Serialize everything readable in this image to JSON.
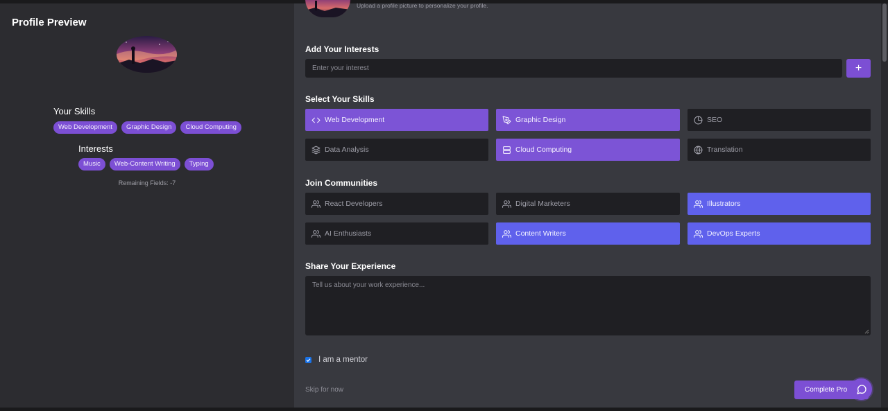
{
  "preview": {
    "title": "Profile Preview",
    "skills_heading": "Your Skills",
    "skills": [
      "Web Development",
      "Graphic Design",
      "Cloud Computing"
    ],
    "interests_heading": "Interests",
    "interests": [
      "Music",
      "Web-Content Writing",
      "Typing"
    ],
    "remaining": "Remaining Fields: -7"
  },
  "form": {
    "upload_hint": "Upload a profile picture to personalize your profile.",
    "interests_label": "Add Your Interests",
    "interest_placeholder": "Enter your interest",
    "add_label": "+",
    "skills_label": "Select Your Skills",
    "skills": [
      {
        "label": "Web Development",
        "icon": "code-icon",
        "selected": true
      },
      {
        "label": "Graphic Design",
        "icon": "pen-tool-icon",
        "selected": true
      },
      {
        "label": "SEO",
        "icon": "pie-chart-icon",
        "selected": false
      },
      {
        "label": "Data Analysis",
        "icon": "layers-icon",
        "selected": false
      },
      {
        "label": "Cloud Computing",
        "icon": "server-icon",
        "selected": true
      },
      {
        "label": "Translation",
        "icon": "globe-icon",
        "selected": false
      }
    ],
    "communities_label": "Join Communities",
    "communities": [
      {
        "label": "React Developers",
        "icon": "users-icon",
        "selected": false
      },
      {
        "label": "Digital Marketers",
        "icon": "users-icon",
        "selected": false
      },
      {
        "label": "Illustrators",
        "icon": "users-icon",
        "selected": true
      },
      {
        "label": "AI Enthusiasts",
        "icon": "users-icon",
        "selected": false
      },
      {
        "label": "Content Writers",
        "icon": "users-icon",
        "selected": true
      },
      {
        "label": "DevOps Experts",
        "icon": "users-icon",
        "selected": true
      }
    ],
    "experience_label": "Share Your Experience",
    "experience_placeholder": "Tell us about your work experience...",
    "mentor_label": "I am a mentor",
    "mentor_checked": true,
    "skip_label": "Skip for now",
    "complete_label": "Complete Pro"
  },
  "colors": {
    "accent": "#7c4fd4",
    "skill_selected": "#7c54d6",
    "community_selected": "#5f61ec",
    "card_bg": "#1f1f23",
    "panel_left": "#2c2c30",
    "panel_right": "#38393f"
  }
}
